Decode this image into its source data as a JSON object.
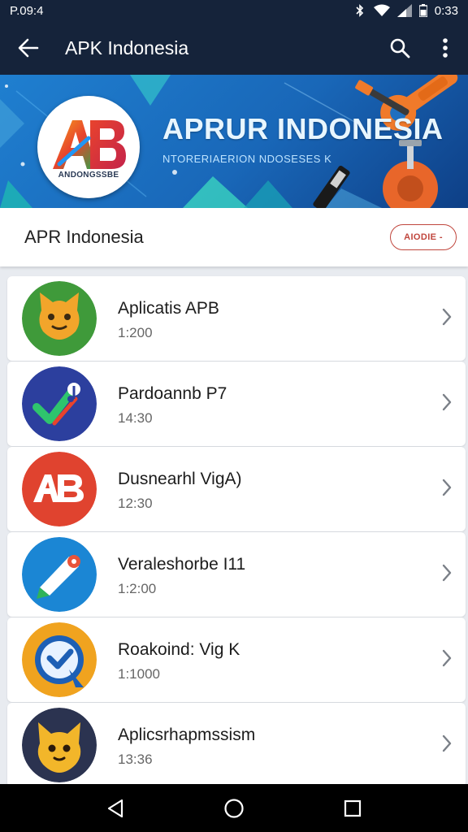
{
  "status_bar": {
    "left_text": "P.09:4",
    "time": "0:33"
  },
  "app_bar": {
    "title": "APK Indonesia",
    "back_icon": "arrow-back-icon",
    "search_icon": "search-icon",
    "menu_icon": "more-vert-icon"
  },
  "banner": {
    "logo_text": "AB",
    "logo_caption": "ANDONGSSBE",
    "title": "APRUR INDONESIA",
    "subtitle": "NTORERIAERION NDOSESES K"
  },
  "header": {
    "title": "APR Indonesia",
    "chip_label": "AIODIE -"
  },
  "apps": [
    {
      "name": "Aplicatis APB",
      "time": "1:200",
      "icon": "cat-face-icon",
      "color": "#3f9a3a"
    },
    {
      "name": "Pardoannb P7",
      "time": "14:30",
      "icon": "checkmark-note-icon",
      "color": "#2c3f9e"
    },
    {
      "name": "Dusnearhl VigA)",
      "time": "12:30",
      "icon": "ab-logo-icon",
      "color": "#e0432f"
    },
    {
      "name": "Veraleshorbe I11",
      "time": "1:2:00",
      "icon": "pencil-icon",
      "color": "#1b86d4"
    },
    {
      "name": "Roakoind: Vig K",
      "time": "1:1000",
      "icon": "check-badge-icon",
      "color": "#f0a31f"
    },
    {
      "name": "Aplicsrhapmssism",
      "time": "13:36",
      "icon": "cat-mascot-icon",
      "color": "#2b3350"
    }
  ],
  "nav": {
    "back": "nav-back-icon",
    "home": "nav-home-icon",
    "recents": "nav-recents-icon"
  }
}
